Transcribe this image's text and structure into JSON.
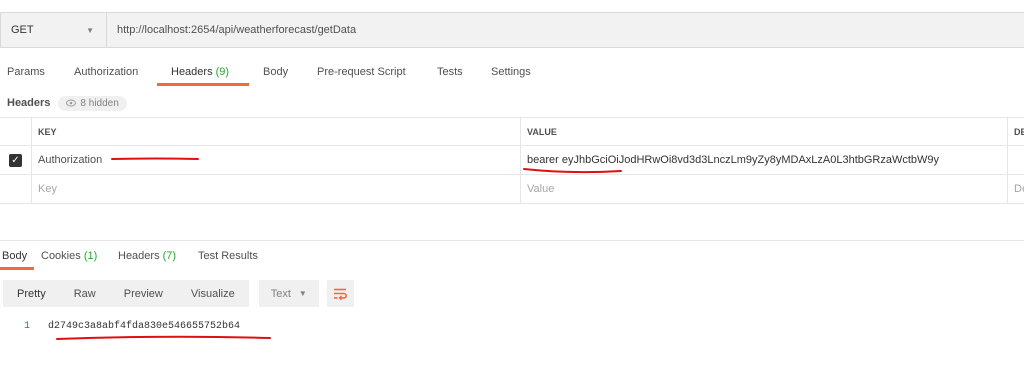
{
  "request": {
    "method": "GET",
    "url": "http://localhost:2654/api/weatherforecast/getData"
  },
  "request_tabs": [
    {
      "label": "Params",
      "count": ""
    },
    {
      "label": "Authorization",
      "count": ""
    },
    {
      "label": "Headers",
      "count": "(9)"
    },
    {
      "label": "Body",
      "count": ""
    },
    {
      "label": "Pre-request Script",
      "count": ""
    },
    {
      "label": "Tests",
      "count": ""
    },
    {
      "label": "Settings",
      "count": ""
    }
  ],
  "headers_section": {
    "label": "Headers",
    "hidden_text": "8 hidden"
  },
  "headers_table": {
    "columns": [
      "KEY",
      "VALUE",
      "DE"
    ],
    "rows": [
      {
        "checked": true,
        "key": "Authorization",
        "value": "bearer eyJhbGciOiJodHRwOi8vd3d3LnczLm9yZy8yMDAxLzA0L3htbGRzaWctbW9y"
      }
    ],
    "placeholder": {
      "key": "Key",
      "value": "Value",
      "desc": "De"
    }
  },
  "response_tabs": [
    {
      "label": "Body",
      "count": ""
    },
    {
      "label": "Cookies",
      "count": "(1)"
    },
    {
      "label": "Headers",
      "count": "(7)"
    },
    {
      "label": "Test Results",
      "count": ""
    }
  ],
  "response_toolbar": {
    "modes": [
      "Pretty",
      "Raw",
      "Preview",
      "Visualize"
    ],
    "format": "Text"
  },
  "response_body": {
    "line_number": "1",
    "content": "d2749c3a8abf4fda830e546655752b64"
  },
  "colors": {
    "accent": "#f26b3a",
    "count_green": "#26a82b",
    "annotation_red": "#e01010"
  }
}
